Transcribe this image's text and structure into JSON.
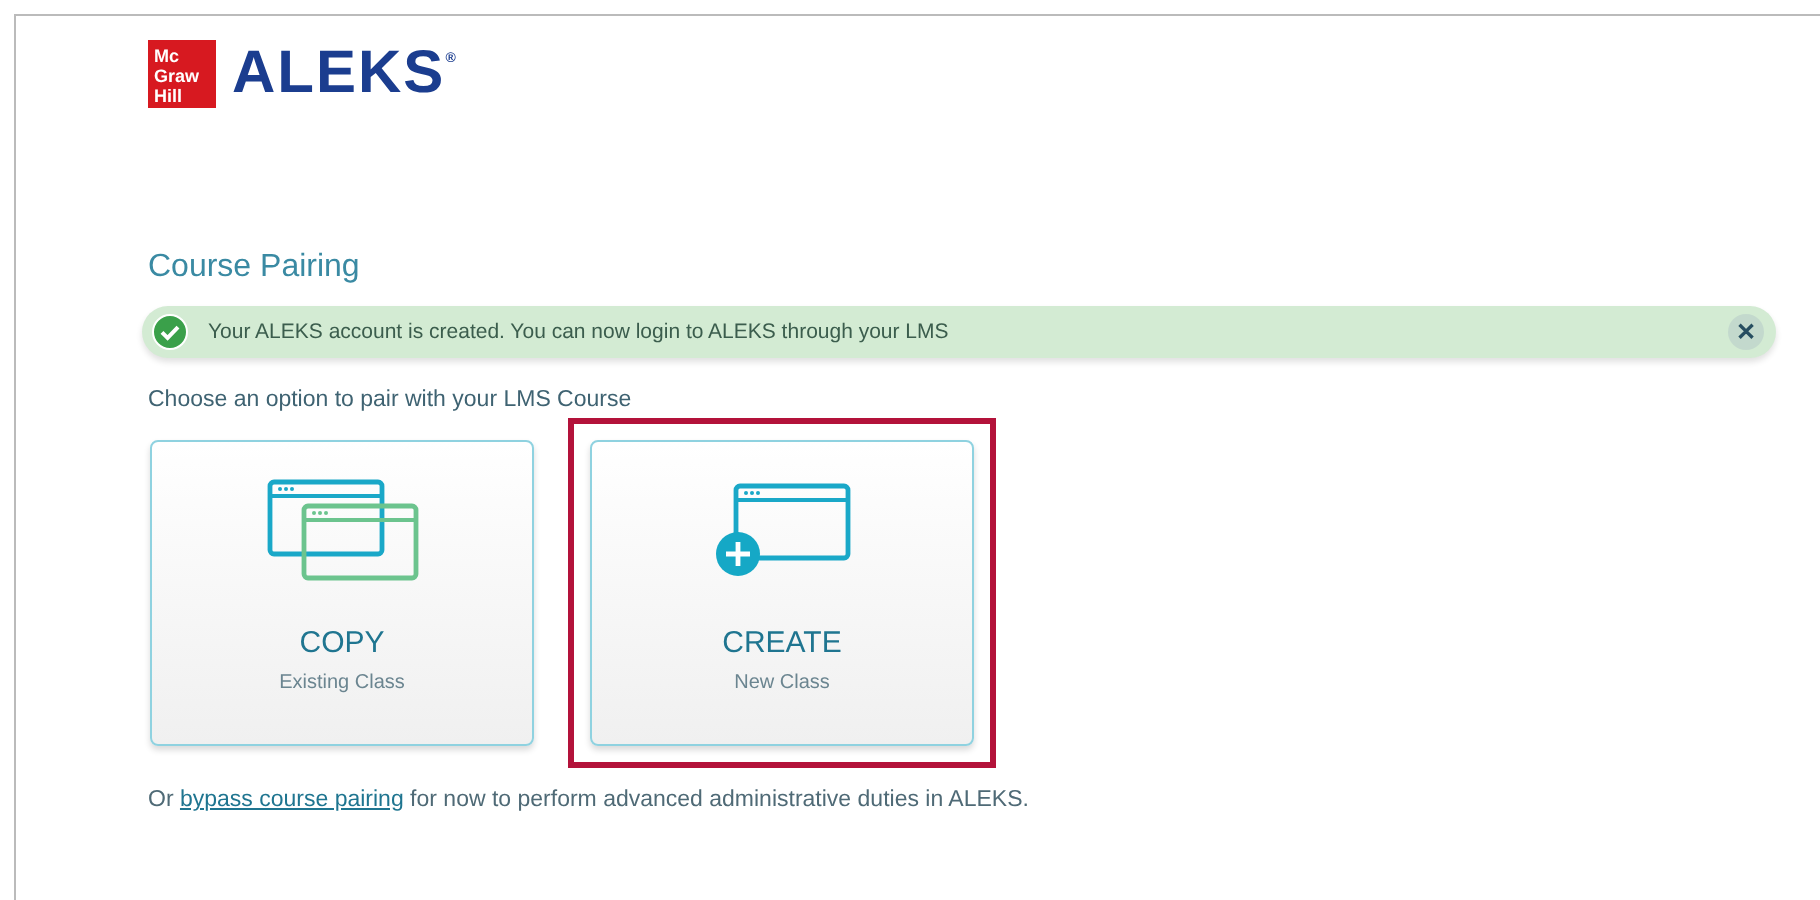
{
  "logo": {
    "badge": [
      "Mc",
      "Graw",
      "Hill"
    ],
    "brand": "ALEKS",
    "mark": "®"
  },
  "title": "Course Pairing",
  "banner": {
    "message": "Your ALEKS account is created. You can now login to ALEKS through your LMS",
    "close": "✕"
  },
  "prompt": "Choose an option to pair with your LMS Course",
  "options": [
    {
      "kind": "copy",
      "label": "COPY",
      "sublabel": "Existing Class",
      "highlighted": false
    },
    {
      "kind": "create",
      "label": "CREATE",
      "sublabel": "New Class",
      "highlighted": true
    }
  ],
  "footer": {
    "before": "Or ",
    "link": "bypass course pairing",
    "after": " for now to perform advanced administrative duties in ALEKS."
  }
}
